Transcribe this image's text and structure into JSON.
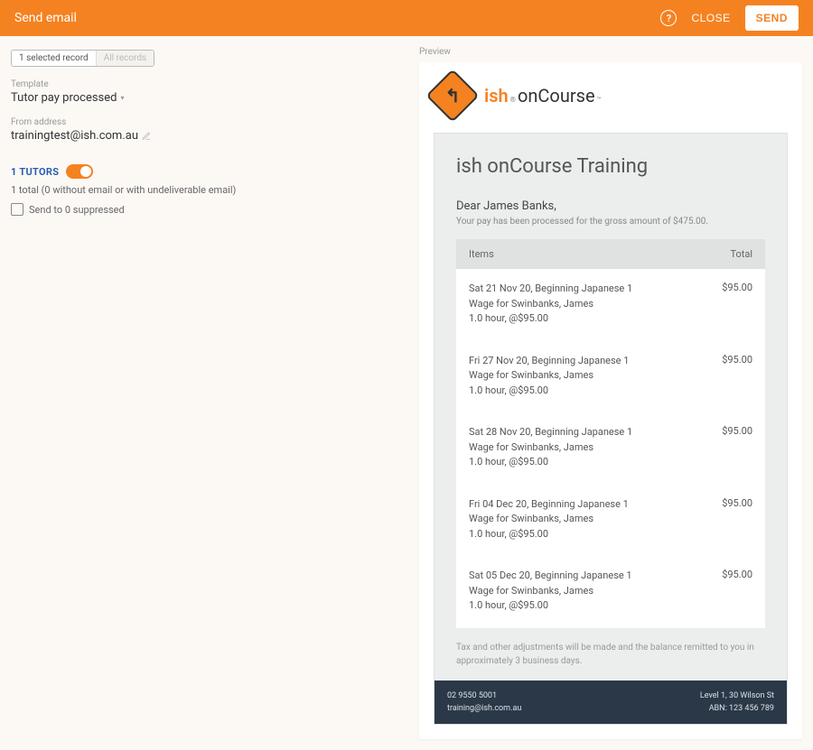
{
  "header": {
    "title": "Send email",
    "close_label": "CLOSE",
    "send_label": "SEND"
  },
  "segmented": {
    "selected": "1 selected record",
    "all": "All records"
  },
  "form": {
    "template_label": "Template",
    "template_value": "Tutor pay processed",
    "from_label": "From address",
    "from_value": "trainingtest@ish.com.au"
  },
  "tutors": {
    "label": "1 TUTORS",
    "summary": "1 total (0 without email or with undeliverable email)",
    "suppressed": "Send to 0 suppressed"
  },
  "preview": {
    "label": "Preview"
  },
  "email": {
    "title": "ish onCourse Training",
    "greeting": "Dear James Banks,",
    "intro": "Your pay has been processed for the gross amount of $475.00.",
    "columns": {
      "items": "Items",
      "total": "Total"
    },
    "rows": [
      {
        "line1": "Sat 21 Nov 20, Beginning Japanese 1",
        "line2": "Wage for Swinbanks, James",
        "line3": "1.0 hour, @$95.00",
        "total": "$95.00"
      },
      {
        "line1": "Fri 27 Nov 20, Beginning Japanese 1",
        "line2": "Wage for Swinbanks, James",
        "line3": "1.0 hour, @$95.00",
        "total": "$95.00"
      },
      {
        "line1": "Sat 28 Nov 20, Beginning Japanese 1",
        "line2": "Wage for Swinbanks, James",
        "line3": "1.0 hour, @$95.00",
        "total": "$95.00"
      },
      {
        "line1": "Fri 04 Dec 20, Beginning Japanese 1",
        "line2": "Wage for Swinbanks, James",
        "line3": "1.0 hour, @$95.00",
        "total": "$95.00"
      },
      {
        "line1": "Sat 05 Dec 20, Beginning Japanese 1",
        "line2": "Wage for Swinbanks, James",
        "line3": "1.0 hour, @$95.00",
        "total": "$95.00"
      }
    ],
    "note": "Tax and other adjustments will be made and the balance remitted to you in approximately 3 business days.",
    "footer": {
      "phone": "02 9550 5001",
      "email": "training@ish.com.au",
      "addr": "Level 1, 30 Wilson St",
      "abn": "ABN: 123 456 789"
    }
  }
}
